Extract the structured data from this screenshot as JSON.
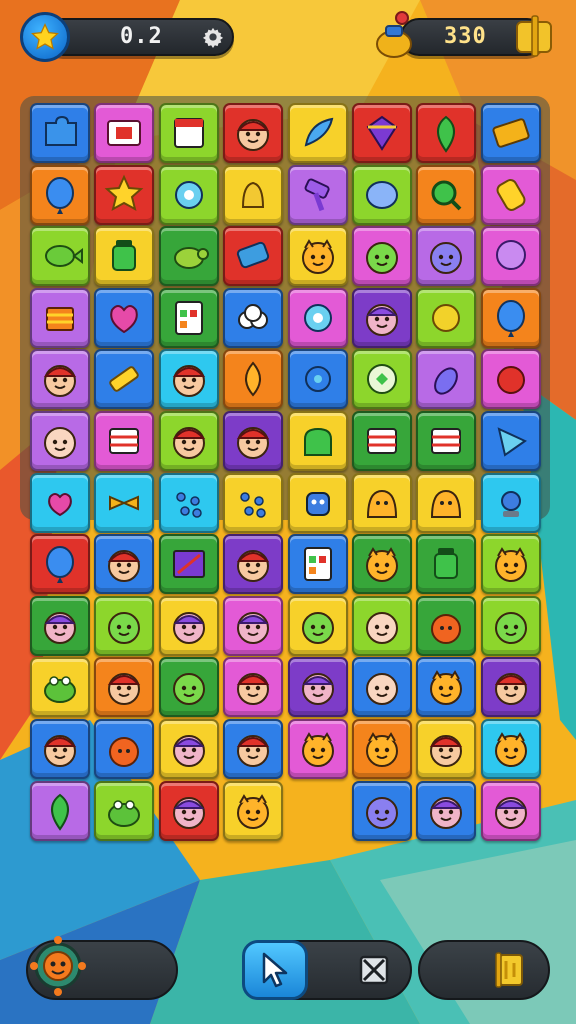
{
  "hud": {
    "score_text": "0.2",
    "coins_text": "330",
    "star_icon": "star-icon",
    "settings_icon": "gear-icon",
    "bag_icon": "bag-icon",
    "wallet_icon": "wallet-icon"
  },
  "toolbar": {
    "character_icon": "character-icon",
    "pointer_icon": "cursor-arrow-icon",
    "shuffle_icon": "crossed-box-icon",
    "flag_icon": "flag-icon"
  },
  "palette": {
    "blue": "#2f7fe8",
    "pink": "#e35ad6",
    "lime": "#8dd62c",
    "red": "#e0322a",
    "yellow": "#f7d12a",
    "green": "#37a63a",
    "orange": "#f4841c",
    "purple": "#7d3cc8",
    "cyan": "#2ec8ef",
    "violet": "#b86ae6"
  },
  "board": {
    "rows": [
      [
        {
          "color": "#2f7fe8",
          "icon": "puzzle-icon"
        },
        {
          "color": "#e35ad6",
          "icon": "card-icon"
        },
        {
          "color": "#8dd62c",
          "icon": "calendar-icon"
        },
        {
          "color": "#e0322a",
          "icon": "face-cap-icon"
        },
        {
          "color": "#f7d12a",
          "icon": "feather-icon"
        },
        {
          "color": "#e0322a",
          "icon": "gem-icon"
        },
        {
          "color": "#e0322a",
          "icon": "leaf-icon"
        },
        {
          "color": "#2f7fe8",
          "icon": "ticket-icon"
        }
      ],
      [
        {
          "color": "#f4841c",
          "icon": "balloon-icon"
        },
        {
          "color": "#e0322a",
          "icon": "star-face-icon"
        },
        {
          "color": "#8dd62c",
          "icon": "flower-icon"
        },
        {
          "color": "#f7d12a",
          "icon": "bell-icon"
        },
        {
          "color": "#b86ae6",
          "icon": "hammer-icon"
        },
        {
          "color": "#8dd62c",
          "icon": "blob-icon"
        },
        {
          "color": "#f4841c",
          "icon": "lens-icon"
        },
        {
          "color": "#e35ad6",
          "icon": "candy-icon"
        }
      ],
      [
        {
          "color": "#8dd62c",
          "icon": "fish-icon"
        },
        {
          "color": "#f7d12a",
          "icon": "jar-icon"
        },
        {
          "color": "#37a63a",
          "icon": "turtle-icon"
        },
        {
          "color": "#e0322a",
          "icon": "robot-icon"
        },
        {
          "color": "#f7d12a",
          "icon": "cat-face-icon"
        },
        {
          "color": "#e35ad6",
          "icon": "blob-face-icon"
        },
        {
          "color": "#b86ae6",
          "icon": "cloud-face-icon"
        },
        {
          "color": "#e35ad6",
          "icon": "bubble-icon"
        }
      ],
      [
        {
          "color": "#b86ae6",
          "icon": "cake-icon"
        },
        {
          "color": "#2f7fe8",
          "icon": "heart-blob-icon"
        },
        {
          "color": "#37a63a",
          "icon": "notepad-icon"
        },
        {
          "color": "#2f7fe8",
          "icon": "cloud-icon"
        },
        {
          "color": "#e35ad6",
          "icon": "flower-icon"
        },
        {
          "color": "#7d3cc8",
          "icon": "hat-face-icon"
        },
        {
          "color": "#8dd62c",
          "icon": "ball-icon"
        },
        {
          "color": "#f4841c",
          "icon": "balloon-icon"
        }
      ],
      [
        {
          "color": "#b86ae6",
          "icon": "face-cap-icon"
        },
        {
          "color": "#2f7fe8",
          "icon": "crayon-icon"
        },
        {
          "color": "#2ec8ef",
          "icon": "face-cap-icon"
        },
        {
          "color": "#f4841c",
          "icon": "drop-face-icon"
        },
        {
          "color": "#2f7fe8",
          "icon": "orb-icon"
        },
        {
          "color": "#8dd62c",
          "icon": "melon-icon"
        },
        {
          "color": "#b86ae6",
          "icon": "eggplant-icon"
        },
        {
          "color": "#e35ad6",
          "icon": "apple-icon"
        }
      ],
      [
        {
          "color": "#b86ae6",
          "icon": "face-icon"
        },
        {
          "color": "#e35ad6",
          "icon": "stripes-icon"
        },
        {
          "color": "#8dd62c",
          "icon": "face-cap-icon"
        },
        {
          "color": "#7d3cc8",
          "icon": "face-cap-icon"
        },
        {
          "color": "#f7d12a",
          "icon": "box-icon"
        },
        {
          "color": "#37a63a",
          "icon": "stripes-icon"
        },
        {
          "color": "#37a63a",
          "icon": "stripes-icon"
        },
        {
          "color": "#2f7fe8",
          "icon": "triangle-icon"
        }
      ],
      [
        {
          "color": "#2ec8ef",
          "icon": "bow-heart-icon"
        },
        {
          "color": "#2ec8ef",
          "icon": "bow-dots-icon"
        },
        {
          "color": "#2ec8ef",
          "icon": "dots-icon"
        },
        {
          "color": "#f7d12a",
          "icon": "dots-icon"
        },
        {
          "color": "#f7d12a",
          "icon": "robot-face-icon"
        },
        {
          "color": "#f7d12a",
          "icon": "monster-icon"
        },
        {
          "color": "#f7d12a",
          "icon": "monster-icon"
        },
        {
          "color": "#2ec8ef",
          "icon": "lamp-icon"
        }
      ],
      [
        {
          "color": "#e0322a",
          "icon": "balloon-icon"
        },
        {
          "color": "#2f7fe8",
          "icon": "face-cap-icon"
        },
        {
          "color": "#37a63a",
          "icon": "frame-icon"
        },
        {
          "color": "#7d3cc8",
          "icon": "face-cap-icon"
        },
        {
          "color": "#2f7fe8",
          "icon": "notepad-icon"
        },
        {
          "color": "#37a63a",
          "icon": "cat-face-icon"
        },
        {
          "color": "#37a63a",
          "icon": "jar-icon"
        },
        {
          "color": "#8dd62c",
          "icon": "cat-face-icon"
        }
      ],
      [
        {
          "color": "#37a63a",
          "icon": "hat-face-icon"
        },
        {
          "color": "#8dd62c",
          "icon": "blob-face-icon"
        },
        {
          "color": "#f7d12a",
          "icon": "hat-face-icon"
        },
        {
          "color": "#e35ad6",
          "icon": "hat-face-icon"
        },
        {
          "color": "#f7d12a",
          "icon": "blob-face-icon"
        },
        {
          "color": "#8dd62c",
          "icon": "face-icon"
        },
        {
          "color": "#37a63a",
          "icon": "tomato-icon"
        },
        {
          "color": "#8dd62c",
          "icon": "blob-face-icon"
        }
      ],
      [
        {
          "color": "#f7d12a",
          "icon": "frog-icon"
        },
        {
          "color": "#f4841c",
          "icon": "face-cap-icon"
        },
        {
          "color": "#37a63a",
          "icon": "blob-face-icon"
        },
        {
          "color": "#e35ad6",
          "icon": "face-cap-icon"
        },
        {
          "color": "#7d3cc8",
          "icon": "hat-face-icon"
        },
        {
          "color": "#2f7fe8",
          "icon": "face-icon"
        },
        {
          "color": "#2f7fe8",
          "icon": "cat-face-icon"
        },
        {
          "color": "#7d3cc8",
          "icon": "face-cap-icon"
        }
      ],
      [
        {
          "color": "#2f7fe8",
          "icon": "face-cap-icon"
        },
        {
          "color": "#2f7fe8",
          "icon": "tomato-icon"
        },
        {
          "color": "#f7d12a",
          "icon": "hat-face-icon"
        },
        {
          "color": "#2f7fe8",
          "icon": "face-cap-icon"
        },
        {
          "color": "#e35ad6",
          "icon": "cat-face-icon"
        },
        {
          "color": "#f4841c",
          "icon": "cat-face-icon"
        },
        {
          "color": "#f7d12a",
          "icon": "face-cap-icon"
        },
        {
          "color": "#2ec8ef",
          "icon": "cat-face-icon"
        }
      ],
      [
        {
          "color": "#b86ae6",
          "icon": "leaf-icon"
        },
        {
          "color": "#8dd62c",
          "icon": "frog-icon"
        },
        {
          "color": "#e0322a",
          "icon": "hat-face-icon"
        },
        {
          "color": "#f7d12a",
          "icon": "cat-face-icon"
        },
        null,
        {
          "color": "#2f7fe8",
          "icon": "cloud-face-icon"
        },
        {
          "color": "#2f7fe8",
          "icon": "hat-face-icon"
        },
        {
          "color": "#e35ad6",
          "icon": "hat-face-icon"
        }
      ]
    ]
  }
}
